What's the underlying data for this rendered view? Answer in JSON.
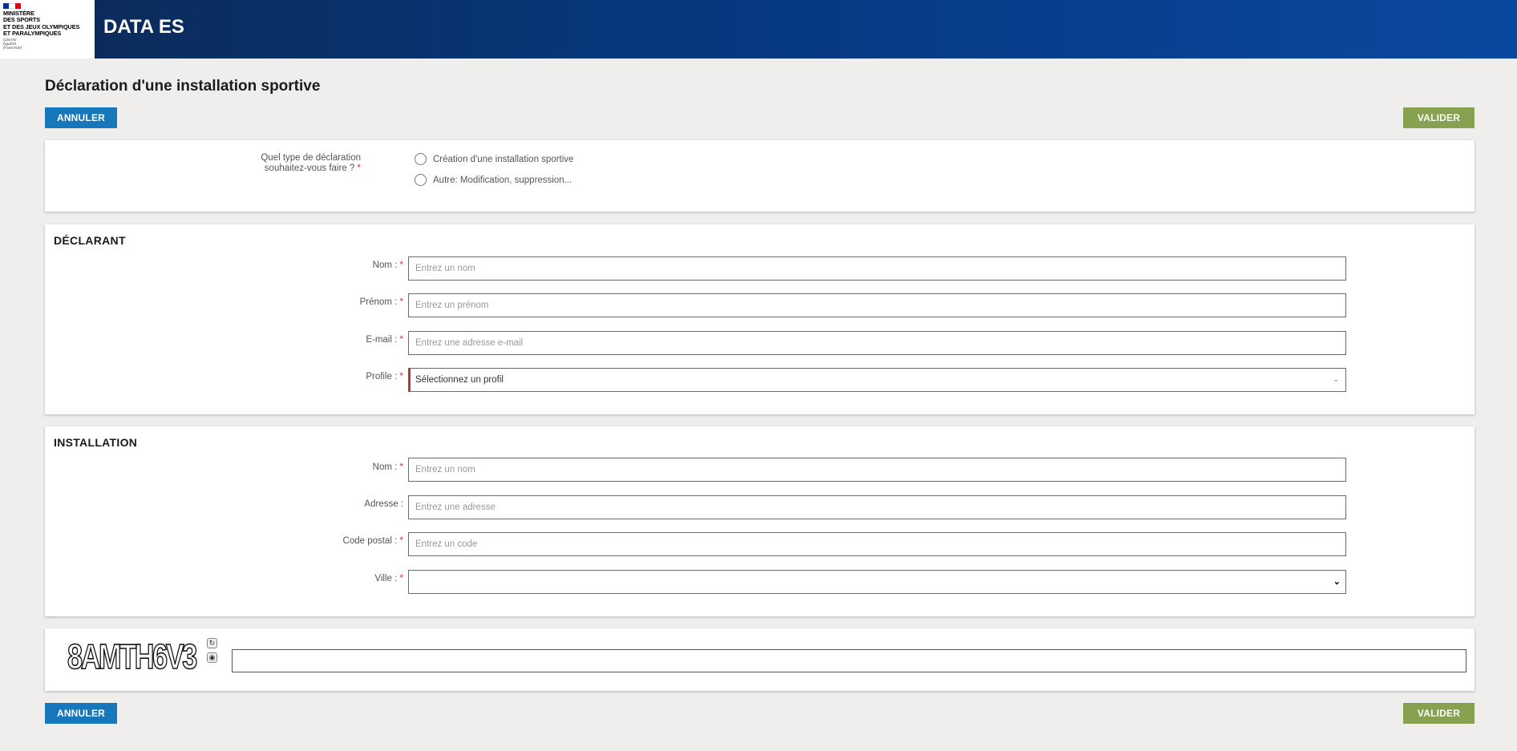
{
  "header": {
    "logo_lines": [
      "MINISTÈRE",
      "DES SPORTS",
      "ET DES JEUX OLYMPIQUES",
      "ET PARALYMPIQUES"
    ],
    "motto": [
      "Liberté",
      "Égalité",
      "Fraternité"
    ],
    "brand": "DATA ES"
  },
  "page": {
    "title": "Déclaration d'une installation sportive",
    "cancel_label": "ANNULER",
    "validate_label": "VALIDER"
  },
  "declaration_type": {
    "question_line1": "Quel type de déclaration",
    "question_line2": "souhaitez-vous faire ?",
    "required_mark": "*",
    "options": [
      "Création d'une installation sportive",
      "Autre: Modification, suppression..."
    ]
  },
  "declarant": {
    "title": "DÉCLARANT",
    "fields": [
      {
        "label": "Nom :",
        "required": "*",
        "placeholder": "Entrez un nom"
      },
      {
        "label": "Prénom :",
        "required": "*",
        "placeholder": "Entrez un prénom"
      },
      {
        "label": "E-mail :",
        "required": "*",
        "placeholder": "Entrez une adresse e-mail"
      },
      {
        "label": "Profile :",
        "required": "*",
        "placeholder": "Sélectionnez un profil"
      }
    ]
  },
  "installation": {
    "title": "INSTALLATION",
    "fields": [
      {
        "label": "Nom :",
        "required": "*",
        "placeholder": "Entrez un nom"
      },
      {
        "label": "Adresse :",
        "required": "",
        "placeholder": "Entrez une adresse"
      },
      {
        "label": "Code postal :",
        "required": "*",
        "placeholder": "Entrez un code"
      },
      {
        "label": "Ville :",
        "required": "*",
        "placeholder": ""
      }
    ]
  },
  "captcha": {
    "text": "8AMTH6V3",
    "refresh_icon": "refresh-icon",
    "audio_icon": "audio-icon"
  }
}
